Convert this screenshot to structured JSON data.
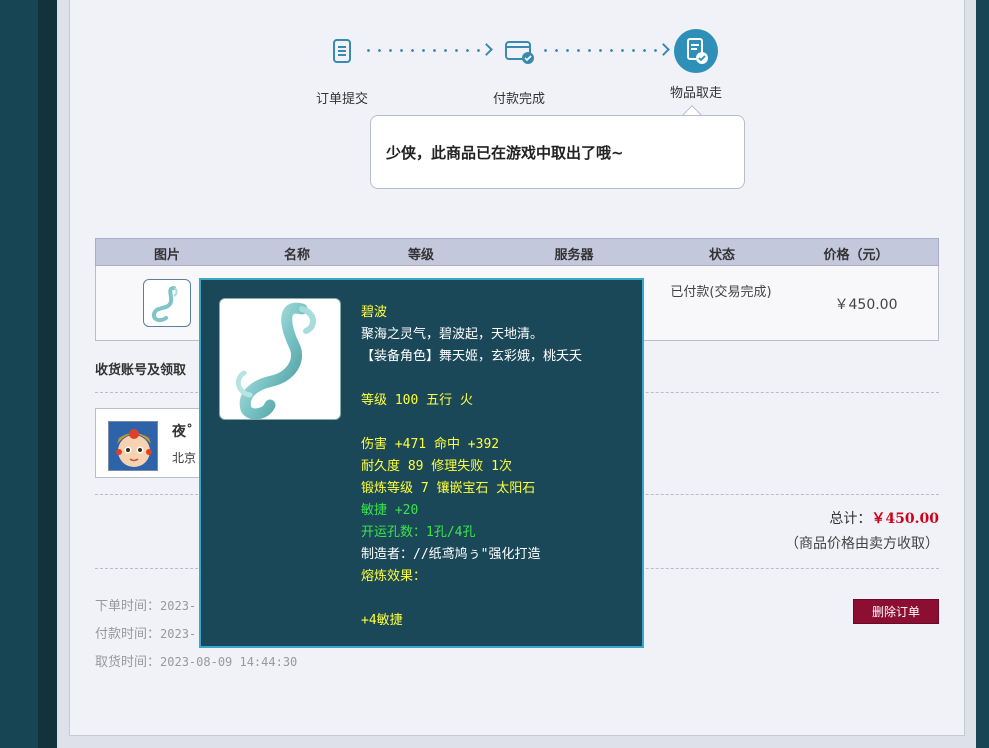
{
  "steps": [
    {
      "label": "订单提交",
      "icon": "document-icon"
    },
    {
      "label": "付款完成",
      "icon": "card-check-icon"
    },
    {
      "label": "物品取走",
      "icon": "document-check-icon"
    }
  ],
  "notice": "少侠，此商品已在游戏中取出了哦~",
  "table": {
    "headers": [
      "图片",
      "名称",
      "等级",
      "服务器",
      "状态",
      "价格（元）"
    ],
    "row": {
      "status": "已付款(交易完成)",
      "price": "￥450.00"
    }
  },
  "account_section": {
    "title": "收货账号及领取",
    "name": "夜˚",
    "server": "北京"
  },
  "total": {
    "label": "总计：",
    "amount": "￥450.00",
    "note": "（商品价格由卖方收取）"
  },
  "times": [
    {
      "label": "下单时间：",
      "value": "2023-"
    },
    {
      "label": "付款时间：",
      "value": "2023-"
    },
    {
      "label": "取货时间：",
      "value": "2023-08-09 14:44:30"
    }
  ],
  "delete_button": "删除订单",
  "tooltip": {
    "lines": [
      {
        "text": "碧波",
        "color": "yellow"
      },
      {
        "text": "聚海之灵气，碧波起，天地清。",
        "color": "white"
      },
      {
        "text": "【装备角色】舞天姬，玄彩娥，桃夭夭",
        "color": "white"
      },
      {
        "text": "",
        "color": "white"
      },
      {
        "text": "等级 100 五行 火",
        "color": "yellow"
      },
      {
        "text": "",
        "color": "white"
      },
      {
        "text": "伤害 +471 命中 +392",
        "color": "yellow"
      },
      {
        "text": "耐久度 89 修理失败 1次",
        "color": "yellow"
      },
      {
        "text": "锻炼等级 7 镶嵌宝石 太阳石",
        "color": "yellow"
      },
      {
        "text": "敏捷 +20",
        "color": "green"
      },
      {
        "text": "开运孔数：1孔/4孔",
        "color": "green"
      },
      {
        "text": "制造者：//纸鸢鸠ぅ\"强化打造",
        "color": "white"
      },
      {
        "text": "熔炼效果：",
        "color": "yellow"
      },
      {
        "text": "",
        "color": "white"
      },
      {
        "text": "+4敏捷",
        "color": "yellow"
      }
    ]
  },
  "colors": {
    "accent": "#3a8ab0",
    "price_red": "#d0021b",
    "delete_button": "#8c0e33",
    "tooltip_bg": "#1b4858",
    "tooltip_border": "#3aa6c8"
  }
}
